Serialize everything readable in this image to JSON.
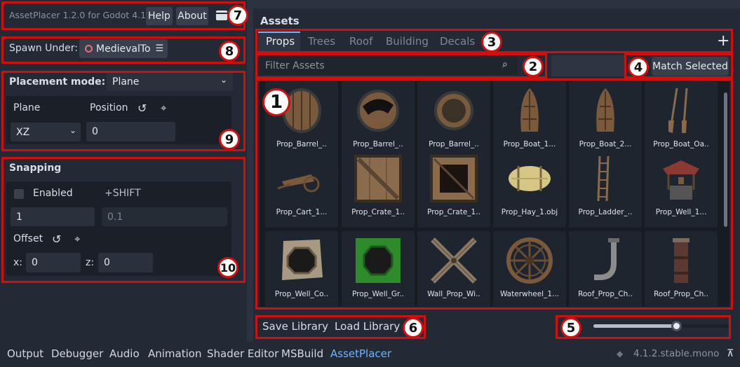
{
  "plugin": {
    "title": "AssetPlacer 1.2.0 for Godot 4.1.",
    "help_label": "Help",
    "about_label": "About"
  },
  "spawn": {
    "label": "Spawn Under:",
    "node_name": "MedievalTo"
  },
  "placement": {
    "mode_label": "Placement mode:",
    "mode_value": "Plane",
    "plane_label": "Plane",
    "position_label": "Position",
    "plane_value": "XZ",
    "position_value": "0"
  },
  "snapping": {
    "title": "Snapping",
    "enabled_label": "Enabled",
    "shift_label": "+SHIFT",
    "step_value": "1",
    "shift_step_value": "0.1",
    "offset_label": "Offset",
    "x_label": "x:",
    "x_value": "0",
    "z_label": "z:",
    "z_value": "0"
  },
  "assets": {
    "title": "Assets",
    "tabs": [
      "Props",
      "Trees",
      "Roof",
      "Building",
      "Decals"
    ],
    "active_tab": "Props",
    "add_label": "+",
    "filter_placeholder": "Filter Assets",
    "match_selected_label": "Match Selected",
    "items": [
      {
        "label": "Prop_Barrel_..",
        "icon": "barrel-icon"
      },
      {
        "label": "Prop_Barrel_..",
        "icon": "barrel-open-icon"
      },
      {
        "label": "Prop_Barrel_..",
        "icon": "barrel-empty-icon"
      },
      {
        "label": "Prop_Boat_1...",
        "icon": "boat-icon"
      },
      {
        "label": "Prop_Boat_2...",
        "icon": "boat-icon"
      },
      {
        "label": "Prop_Boat_Oa..",
        "icon": "oars-icon"
      },
      {
        "label": "Prop_Cart_1...",
        "icon": "cart-icon"
      },
      {
        "label": "Prop_Crate_1..",
        "icon": "crate-icon"
      },
      {
        "label": "Prop_Crate_1..",
        "icon": "crate-open-icon"
      },
      {
        "label": "Prop_Hay_1.obj",
        "icon": "hay-icon"
      },
      {
        "label": "Prop_Ladder_..",
        "icon": "ladder-icon"
      },
      {
        "label": "Prop_Well_1...",
        "icon": "well-icon"
      },
      {
        "label": "Prop_Well_Co..",
        "icon": "well-cover-icon"
      },
      {
        "label": "Prop_Well_Gr..",
        "icon": "well-green-icon"
      },
      {
        "label": "Wall_Prop_Wi..",
        "icon": "windmill-icon"
      },
      {
        "label": "Waterwheel_1...",
        "icon": "waterwheel-icon"
      },
      {
        "label": "Roof_Prop_Ch..",
        "icon": "chimney-pipe-icon"
      },
      {
        "label": "Roof_Prop_Ch..",
        "icon": "chimney-icon"
      }
    ]
  },
  "library": {
    "save_label": "Save Library",
    "load_label": "Load Library"
  },
  "thumbnail_size": 0.61,
  "bottom_tabs": [
    "Output",
    "Debugger",
    "Audio",
    "Animation",
    "Shader Editor",
    "MSBuild",
    "AssetPlacer"
  ],
  "active_bottom_tab": "AssetPlacer",
  "version": "4.1.2.stable.mono",
  "badges": [
    "1",
    "2",
    "3",
    "4",
    "5",
    "6",
    "7",
    "8",
    "9",
    "10"
  ],
  "colors": {
    "annotation": "#d10f0f",
    "accent": "#6eb4ff",
    "panel": "#2b3240",
    "field": "#1f242d"
  }
}
